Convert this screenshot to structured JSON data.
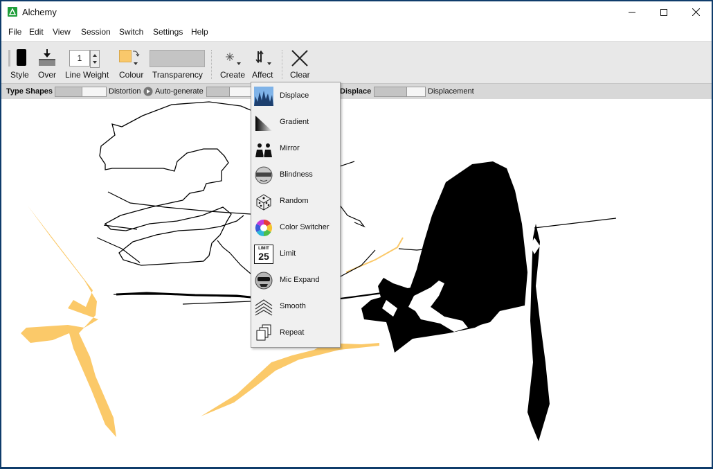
{
  "window": {
    "title": "Alchemy"
  },
  "menubar": [
    "File",
    "Edit",
    "View",
    "Session",
    "Switch",
    "Settings",
    "Help"
  ],
  "toolbar": {
    "style": "Style",
    "over": "Over",
    "line_weight": "Line Weight",
    "line_weight_value": "1",
    "colour": "Colour",
    "colour_value": "#f9c86b",
    "transparency": "Transparency",
    "create": "Create",
    "affect": "Affect",
    "clear": "Clear"
  },
  "subbar": {
    "type_shapes": "Type Shapes",
    "distortion": "Distortion",
    "auto_generate": "Auto-generate",
    "displace": "Displace",
    "displacement": "Displacement"
  },
  "affect_menu": {
    "items": [
      {
        "label": "Displace",
        "icon": "displace-icon"
      },
      {
        "label": "Gradient",
        "icon": "gradient-icon"
      },
      {
        "label": "Mirror",
        "icon": "mirror-icon"
      },
      {
        "label": "Blindness",
        "icon": "blindness-icon"
      },
      {
        "label": "Random",
        "icon": "dice-icon"
      },
      {
        "label": "Color Switcher",
        "icon": "color-wheel-icon"
      },
      {
        "label": "Limit",
        "icon": "limit-icon"
      },
      {
        "label": "Mic Expand",
        "icon": "mic-face-icon"
      },
      {
        "label": "Smooth",
        "icon": "smooth-icon"
      },
      {
        "label": "Repeat",
        "icon": "repeat-icon"
      }
    ],
    "limit_icon_text": "LIMIT",
    "limit_icon_number": "25",
    "highlighted": "Displace"
  },
  "colors": {
    "accent_yellow": "#f9c86b",
    "ink": "#000000"
  }
}
